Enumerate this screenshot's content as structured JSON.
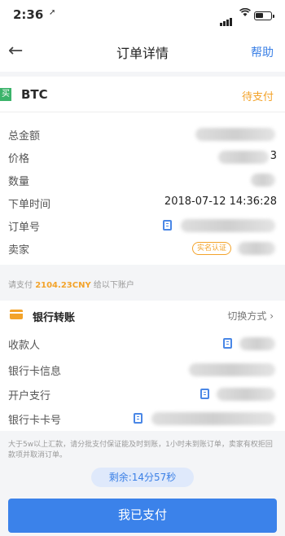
{
  "status_bar": {
    "time": "2:36",
    "location_glyph": "➚"
  },
  "nav": {
    "back_glyph": "←",
    "title": "订单详情",
    "help": "帮助"
  },
  "coin": {
    "tag": "买",
    "name": "BTC",
    "status": "待支付"
  },
  "details": {
    "total_label": "总金额",
    "price_label": "价格",
    "price_value_tail": "3",
    "quantity_label": "数量",
    "order_time_label": "下单时间",
    "order_time_value": "2018-07-12 14:36:28",
    "order_no_label": "订单号",
    "seller_label": "卖家",
    "seller_badge": "实名认证"
  },
  "notice": {
    "prefix": "请支付 ",
    "amount": "2104.23CNY",
    "suffix": " 给以下账户"
  },
  "bank": {
    "title": "银行转账",
    "switch_label": "切换方式",
    "switch_chevron": "›",
    "payee_label": "收款人",
    "card_info_label": "银行卡信息",
    "branch_label": "开户支行",
    "card_number_label": "银行卡卡号"
  },
  "warning": "大于5w以上汇款，请分批支付保证能及时到账，1小时未到账订单，卖家有权拒回款项并取消订单。",
  "timer": "剩余:14分57秒",
  "paid_button": "我已支付",
  "colors": {
    "accent": "#3b80e6",
    "warning": "#f3a32a",
    "buy_tag": "#3bb36a"
  }
}
